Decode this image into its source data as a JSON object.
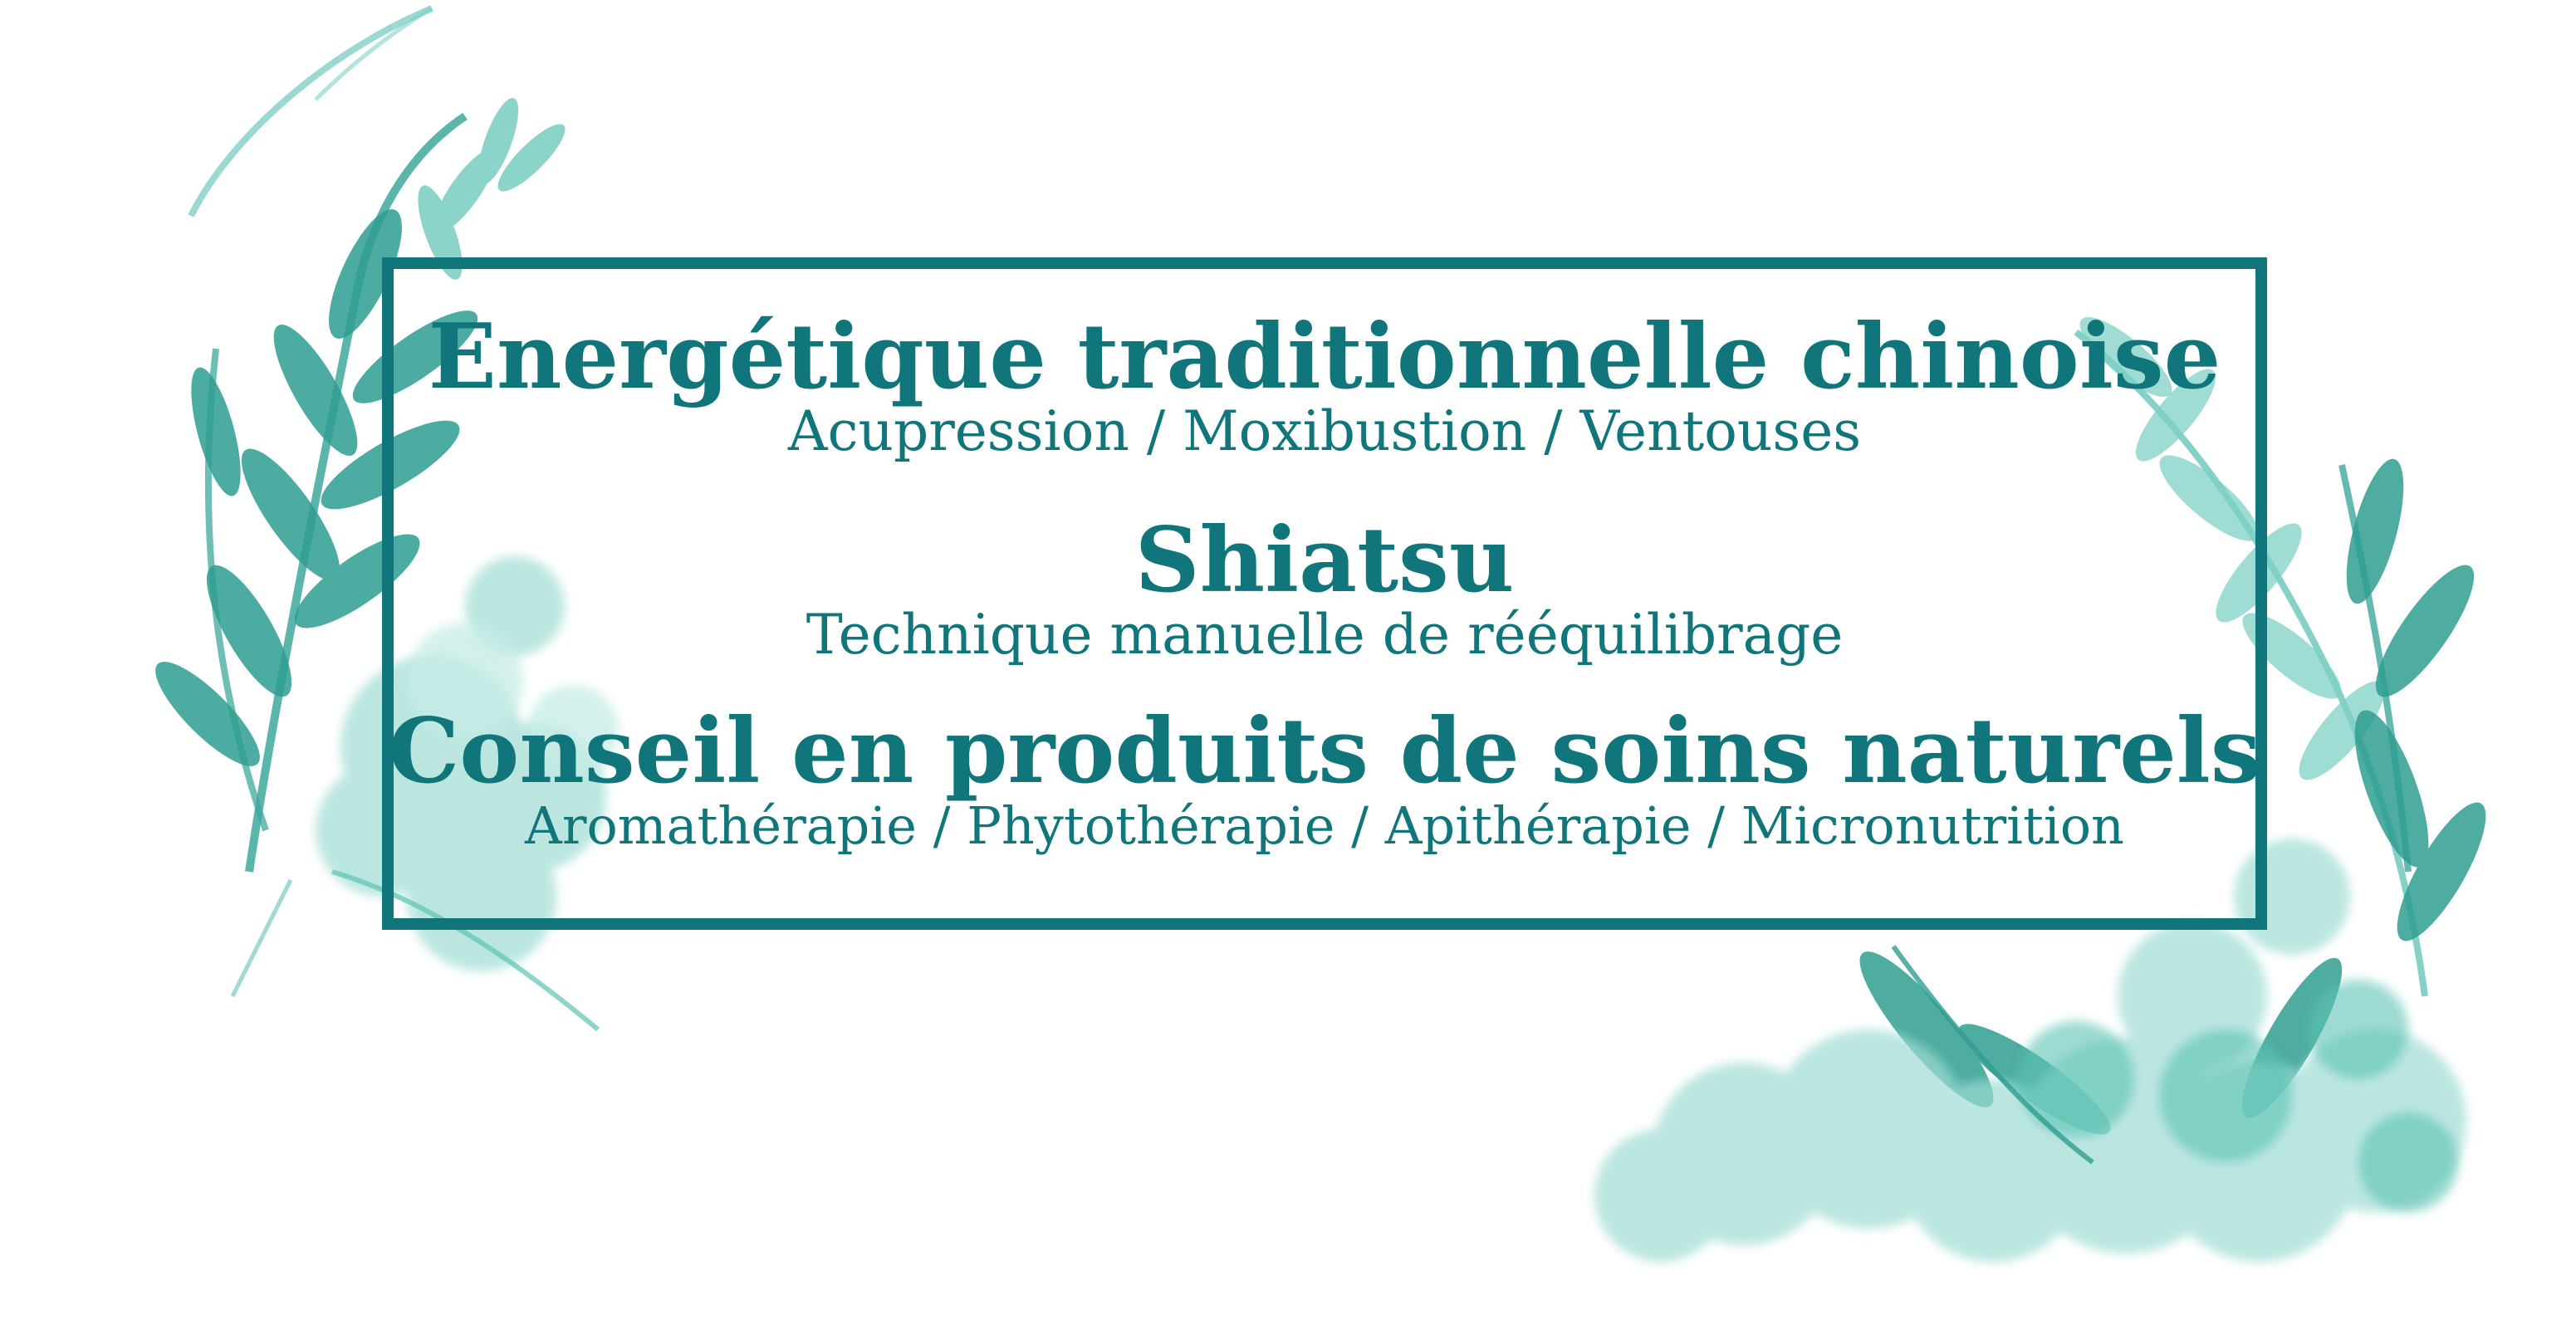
{
  "colors": {
    "primary_teal": "#10767c",
    "leaf_light": "#9fdcd3",
    "leaf_mid": "#5cc2b4",
    "leaf_dark": "#2a9d91"
  },
  "sections": [
    {
      "title": "Energétique traditionnelle chinoise",
      "subtitle": "Acupression / Moxibustion / Ventouses"
    },
    {
      "title": "Shiatsu",
      "subtitle": "Technique manuelle de rééquilibrage"
    },
    {
      "title": "Conseil en produits de soins naturels",
      "subtitle": "Aromathérapie / Phytothérapie / Apithérapie / Micronutrition"
    }
  ]
}
